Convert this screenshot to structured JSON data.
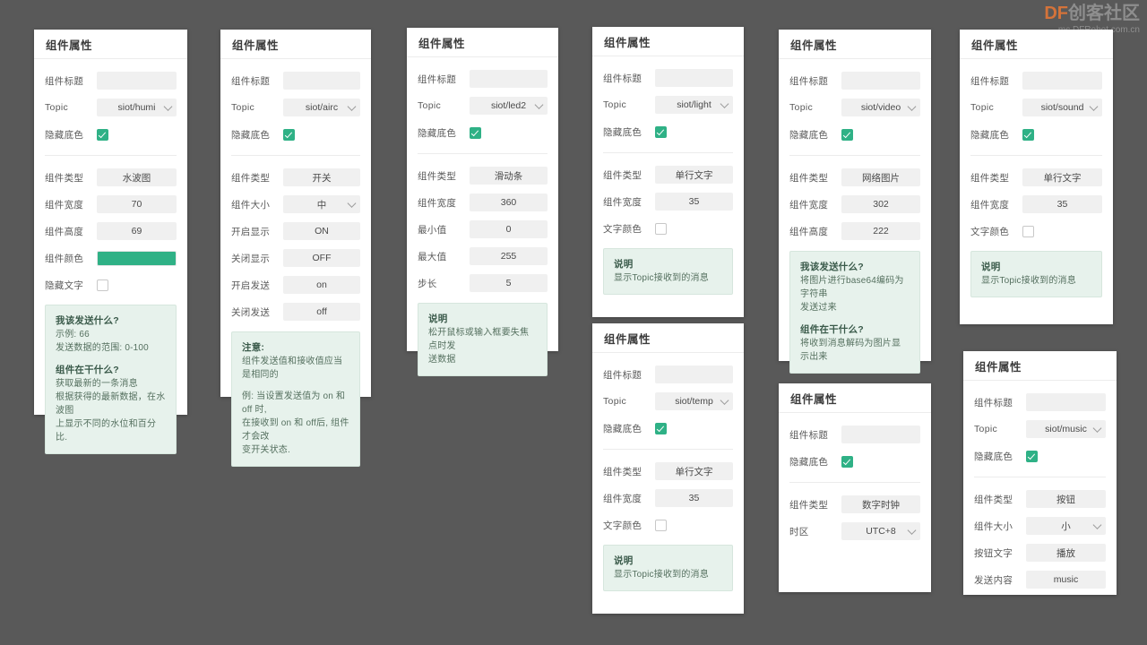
{
  "watermark": {
    "brand_prefix": "DF",
    "brand_suffix": "创客社区",
    "url": "mc.DFRobot.com.cn",
    "brand_color": "#d4733a"
  },
  "theme": {
    "page_background": "#595959",
    "panel_background": "#ffffff",
    "field_background": "#f0f0f0",
    "accent": "#2fb186",
    "info_background": "#e7f2ec",
    "info_border": "#d6e6dd"
  },
  "common": {
    "title": "组件属性",
    "label_component_title": "组件标题",
    "label_topic": "Topic",
    "label_hide_background": "隐藏底色",
    "label_component_type": "组件类型",
    "label_component_width": "组件宽度",
    "label_component_height": "组件高度",
    "label_component_color": "组件颜色",
    "label_component_size": "组件大小",
    "label_hide_text": "隐藏文字",
    "label_text_color": "文字颜色",
    "label_min_value": "最小值",
    "label_max_value": "最大值",
    "label_step": "步长",
    "label_on_display": "开启显示",
    "label_off_display": "关闭显示",
    "label_on_send": "开启发送",
    "label_off_send": "关闭发送",
    "label_timezone": "时区",
    "label_button_text": "按钮文字",
    "label_send_content": "发送内容",
    "title_placeholder": ""
  },
  "panels": [
    {
      "id": "humi-wave",
      "title": "组件属性",
      "component_title_value": "",
      "topic": "siot/humi",
      "hide_background_checked": true,
      "component_type": "水波图",
      "component_width": "70",
      "component_height": "69",
      "component_color": "#2fb186",
      "hide_text_checked": false,
      "info": [
        {
          "heading": "我该发送什么?",
          "lines": [
            "示例: 66",
            "发送数据的范围: 0-100"
          ]
        },
        {
          "heading": "组件在干什么?",
          "lines": [
            "获取最新的一条消息",
            "根据获得的最新数据，在水波图",
            "上显示不同的水位和百分比."
          ]
        }
      ]
    },
    {
      "id": "airc-switch",
      "title": "组件属性",
      "component_title_value": "",
      "topic": "siot/airc",
      "hide_background_checked": true,
      "component_type": "开关",
      "component_size": "中",
      "on_display": "ON",
      "off_display": "OFF",
      "on_send": "on",
      "off_send": "off",
      "info": [
        {
          "heading": "注意:",
          "lines": [
            "组件发送值和接收值应当是相同的"
          ]
        },
        {
          "heading": "",
          "lines": [
            "例: 当设置发送值为 on 和 off 时,",
            "在接收到 on 和 off后, 组件才会改",
            "变开关状态."
          ]
        }
      ]
    },
    {
      "id": "led2-slider",
      "title": "组件属性",
      "component_title_value": "",
      "topic": "siot/led2",
      "hide_background_checked": true,
      "component_type": "滑动条",
      "component_width": "360",
      "min_value": "0",
      "max_value": "255",
      "step": "5",
      "info": [
        {
          "heading": "说明",
          "lines": [
            "松开鼠标或输入框要失焦点时发",
            "送数据"
          ]
        }
      ]
    },
    {
      "id": "light-text",
      "title": "组件属性",
      "component_title_value": "",
      "topic": "siot/light",
      "hide_background_checked": true,
      "component_type": "单行文字",
      "component_width": "35",
      "text_color_checked": false,
      "info": [
        {
          "heading": "说明",
          "lines": [
            "显示Topic接收到的消息"
          ]
        }
      ]
    },
    {
      "id": "temp-text",
      "title": "组件属性",
      "component_title_value": "",
      "topic": "siot/temp",
      "hide_background_checked": true,
      "component_type": "单行文字",
      "component_width": "35",
      "text_color_checked": false,
      "info": [
        {
          "heading": "说明",
          "lines": [
            "显示Topic接收到的消息"
          ]
        }
      ]
    },
    {
      "id": "video-image",
      "title": "组件属性",
      "component_title_value": "",
      "topic": "siot/video",
      "hide_background_checked": true,
      "component_type": "网络图片",
      "component_width": "302",
      "component_height": "222",
      "info": [
        {
          "heading": "我该发送什么?",
          "lines": [
            "将图片进行base64编码为字符串",
            "发送过来"
          ]
        },
        {
          "heading": "组件在干什么?",
          "lines": [
            "将收到消息解码为图片显示出来"
          ]
        }
      ]
    },
    {
      "id": "clock",
      "title": "组件属性",
      "component_title_value": "",
      "hide_background_checked": true,
      "component_type": "数字时钟",
      "timezone": "UTC+8"
    },
    {
      "id": "sound-text",
      "title": "组件属性",
      "component_title_value": "",
      "topic": "siot/sound",
      "hide_background_checked": true,
      "component_type": "单行文字",
      "component_width": "35",
      "text_color_checked": false,
      "info": [
        {
          "heading": "说明",
          "lines": [
            "显示Topic接收到的消息"
          ]
        }
      ]
    },
    {
      "id": "music-button",
      "title": "组件属性",
      "component_title_value": "",
      "topic": "siot/music",
      "hide_background_checked": true,
      "component_type": "按钮",
      "component_size": "小",
      "button_text": "播放",
      "send_content": "music"
    }
  ]
}
